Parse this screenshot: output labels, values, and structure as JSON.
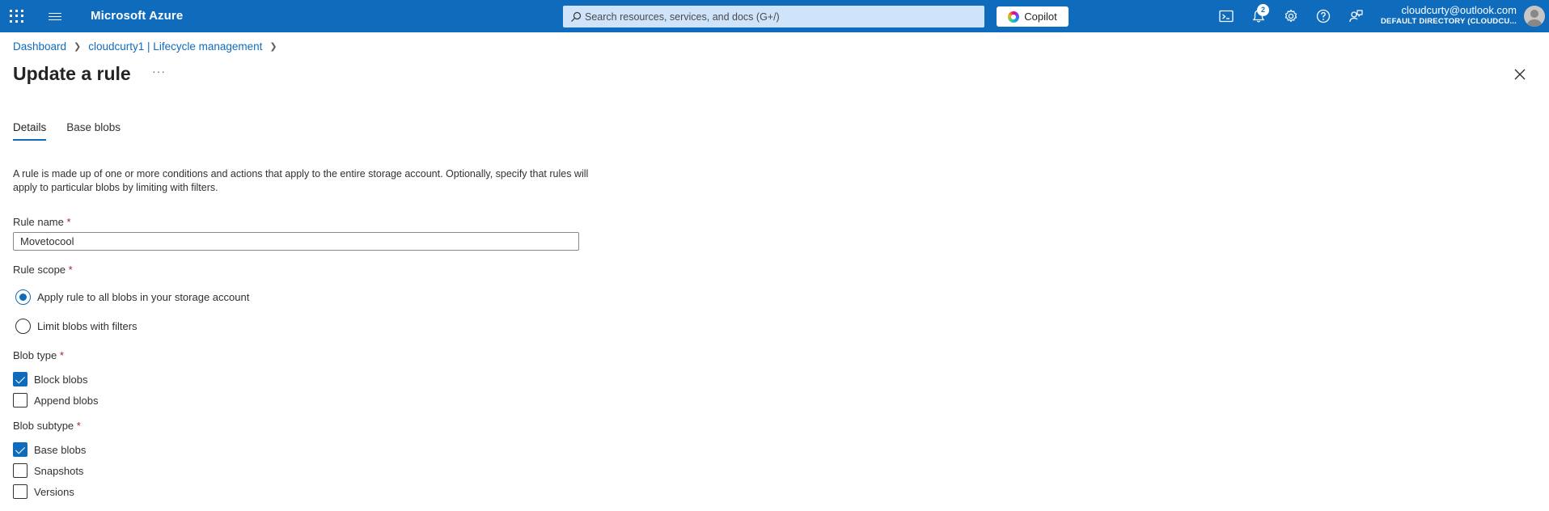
{
  "topbar": {
    "brand": "Microsoft Azure",
    "search_placeholder": "Search resources, services, and docs (G+/)",
    "copilot_label": "Copilot",
    "notification_count": "2",
    "account_email": "cloudcurty@outlook.com",
    "account_directory": "DEFAULT DIRECTORY (CLOUDCU...",
    "accent_color": "#0f6cbd",
    "icons": [
      "waffle-icon",
      "hamburger-icon",
      "search-icon",
      "cloud-shell-icon",
      "bell-icon",
      "gear-icon",
      "help-icon",
      "feedback-icon"
    ]
  },
  "breadcrumb": {
    "items": [
      "Dashboard",
      "cloudcurty1 | Lifecycle management"
    ]
  },
  "page": {
    "title": "Update a rule",
    "more": "···"
  },
  "tabs": [
    {
      "label": "Details",
      "active": true
    },
    {
      "label": "Base blobs",
      "active": false
    }
  ],
  "description": "A rule is made up of one or more conditions and actions that apply to the entire storage account. Optionally, specify that rules will apply to particular blobs by limiting with filters.",
  "form": {
    "rule_name": {
      "label": "Rule name",
      "required": "*",
      "value": "Movetocool"
    },
    "rule_scope": {
      "label": "Rule scope",
      "required": "*",
      "options": [
        {
          "label": "Apply rule to all blobs in your storage account",
          "checked": true
        },
        {
          "label": "Limit blobs with filters",
          "checked": false
        }
      ]
    },
    "blob_type": {
      "label": "Blob type",
      "required": "*",
      "options": [
        {
          "label": "Block blobs",
          "checked": true
        },
        {
          "label": "Append blobs",
          "checked": false
        }
      ]
    },
    "blob_subtype": {
      "label": "Blob subtype",
      "required": "*",
      "options": [
        {
          "label": "Base blobs",
          "checked": true
        },
        {
          "label": "Snapshots",
          "checked": false
        },
        {
          "label": "Versions",
          "checked": false
        }
      ]
    }
  }
}
